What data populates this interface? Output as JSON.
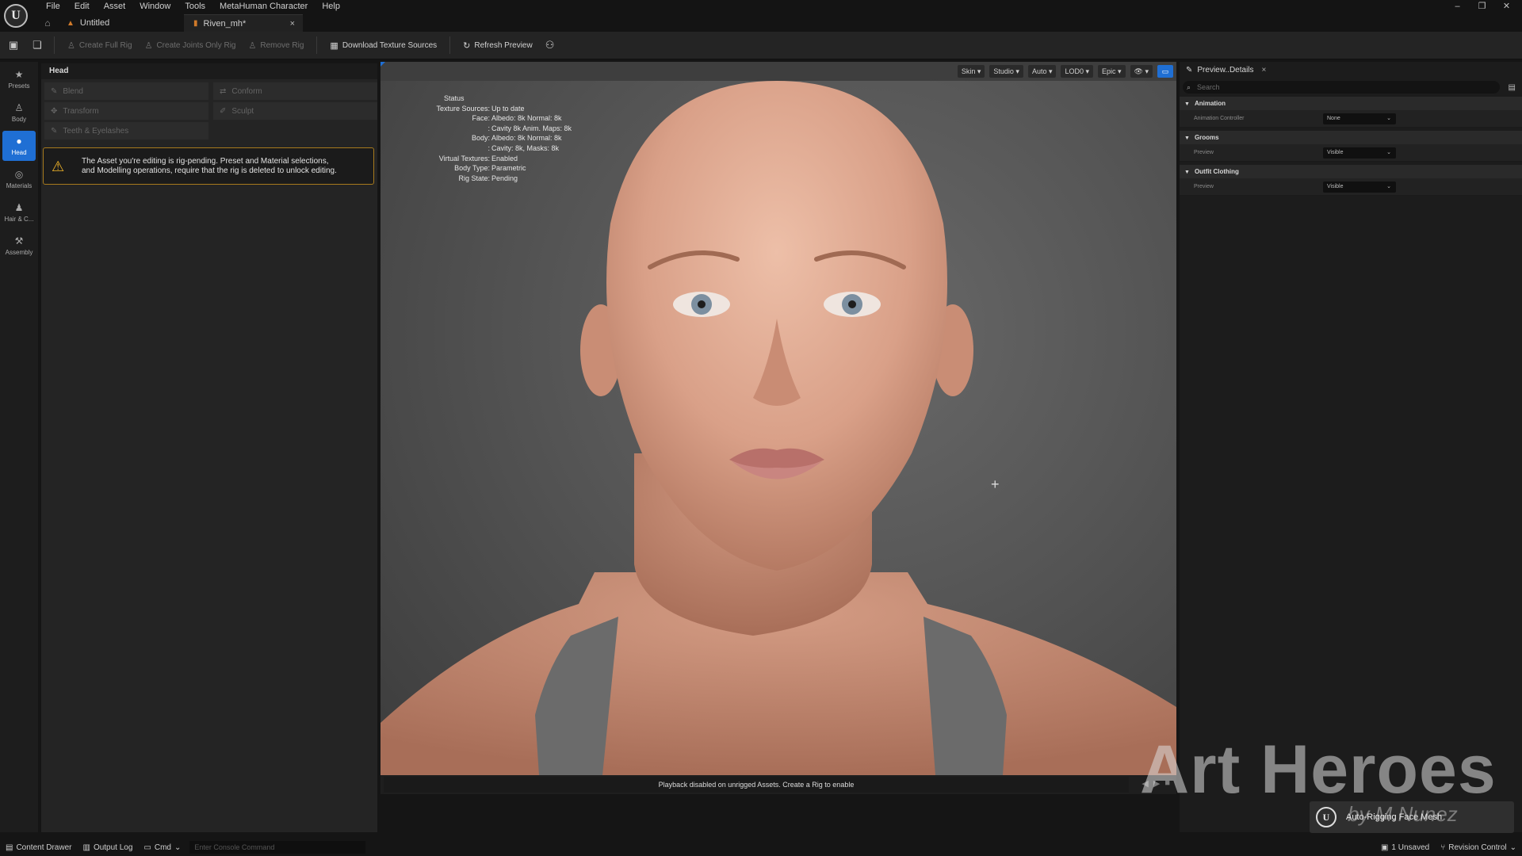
{
  "menu": [
    "File",
    "Edit",
    "Asset",
    "Window",
    "Tools",
    "MetaHuman Character",
    "Help"
  ],
  "tabs": [
    {
      "label": "Untitled"
    },
    {
      "label": "Riven_mh*",
      "close": "×"
    }
  ],
  "window_controls": [
    "–",
    "❐",
    "✕"
  ],
  "toolbar": {
    "create_full_rig": "Create Full Rig",
    "create_joints_only_rig": "Create Joints Only Rig",
    "remove_rig": "Remove Rig",
    "download_texture_sources": "Download Texture Sources",
    "refresh_preview": "Refresh Preview"
  },
  "modes": [
    {
      "label": "Presets",
      "icon": "★"
    },
    {
      "label": "Body",
      "icon": "♙"
    },
    {
      "label": "Head",
      "icon": "●",
      "active": true
    },
    {
      "label": "Materials",
      "icon": "◎"
    },
    {
      "label": "Hair & C...",
      "icon": "♟"
    },
    {
      "label": "Assembly",
      "icon": "⚒"
    }
  ],
  "left_panel": {
    "title": "Head",
    "tools": [
      {
        "label": "Blend",
        "icon": "✎"
      },
      {
        "label": "Conform",
        "icon": "⇄"
      },
      {
        "label": "Transform",
        "icon": "✥"
      },
      {
        "label": "Sculpt",
        "icon": "✐"
      },
      {
        "label": "Teeth & Eyelashes",
        "icon": "✎"
      }
    ],
    "warning_line1": "The Asset you're editing is rig-pending. Preset and Material selections,",
    "warning_line2": "and Modelling operations, require that the rig is deleted to unlock editing."
  },
  "viewport": {
    "toolbar": [
      "Skin ▾",
      "Studio ▾",
      "Auto ▾",
      "LOD0 ▾",
      "Epic ▾",
      "👁 ▾"
    ],
    "status_title": "Status",
    "status": [
      {
        "k": "Texture Sources:",
        "v": "Up to date"
      },
      {
        "k": "Face:",
        "v": "Albedo: 8k Normal: 8k"
      },
      {
        "k": ":",
        "v": "Cavity 8k  Anim. Maps: 8k"
      },
      {
        "k": "Body:",
        "v": "Albedo: 8k Normal: 8k"
      },
      {
        "k": ":",
        "v": "Cavity: 8k, Masks: 8k"
      },
      {
        "k": "Virtual Textures:",
        "v": "Enabled"
      },
      {
        "k": "Body Type:",
        "v": "Parametric"
      },
      {
        "k": "Rig State:",
        "v": "Pending"
      }
    ],
    "playback_message": "Playback disabled on unrigged Assets. Create a Rig to enable",
    "playback_controls": [
      "◀",
      "▶",
      "■"
    ]
  },
  "details": {
    "tab_label": "Preview..Details",
    "search_placeholder": "Search",
    "sections": [
      {
        "title": "Animation",
        "rows": [
          {
            "label": "Animation Controller",
            "value": "None"
          }
        ]
      },
      {
        "title": "Grooms",
        "rows": [
          {
            "label": "Preview",
            "value": "Visible"
          }
        ]
      },
      {
        "title": "Outfit Clothing",
        "rows": [
          {
            "label": "Preview",
            "value": "Visible"
          }
        ]
      }
    ]
  },
  "watermark": {
    "brand": "Art Heroes",
    "sub": "by M.Nunez"
  },
  "toast": {
    "text": "Auto-Rigging Face Mesh"
  },
  "statusbar": {
    "content_drawer": "Content Drawer",
    "output_log": "Output Log",
    "cmd": "Cmd",
    "console_placeholder": "Enter Console Command",
    "unsaved": "1 Unsaved",
    "revision_control": "Revision Control"
  },
  "colors": {
    "accent": "#1f6fd4",
    "warning": "#f0b429",
    "skin": "#e3b09a"
  }
}
